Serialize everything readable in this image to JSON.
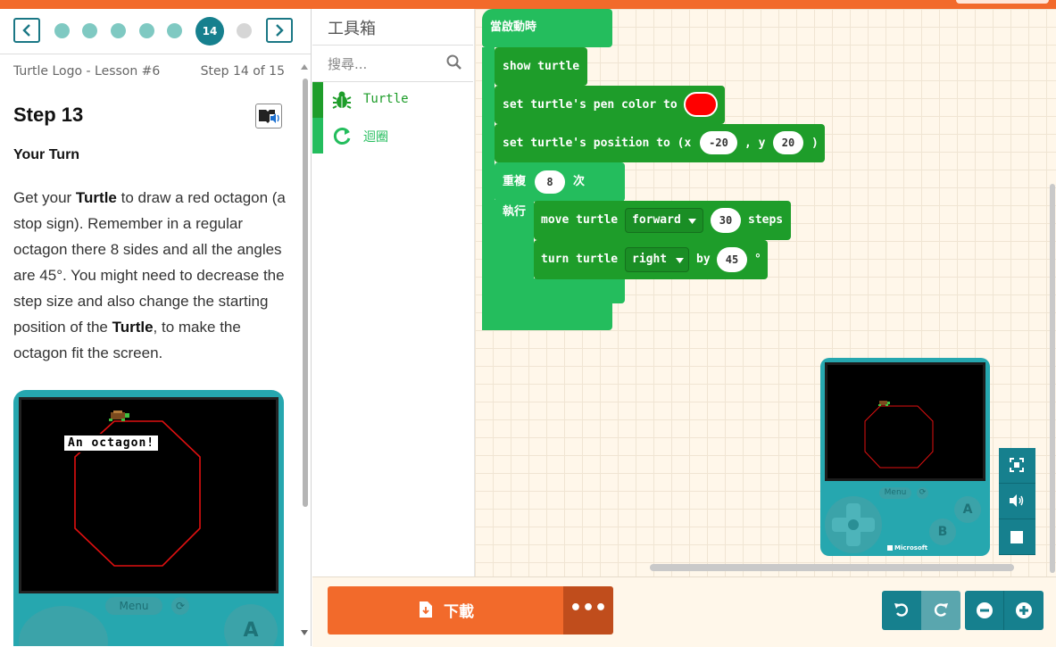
{
  "tutorial": {
    "nav": {
      "current_step": "14"
    },
    "tutorial_name": "Turtle Logo - Lesson #6",
    "step_counter": "Step 14 of 15",
    "step_title": "Step 13",
    "subtitle": "Your Turn",
    "paragraph": {
      "p1": "Get your ",
      "b1": "Turtle",
      "p2": " to draw a red octagon (a stop sign). Remember in a regular octagon there 8 sides and all the angles are 45°. You might need to decrease the step size and also change the starting position of the ",
      "b2": "Turtle",
      "p3": ", to make the octagon fit the screen."
    },
    "preview": {
      "speech": "An octagon!",
      "menu_label": "Menu",
      "a_label": "A"
    }
  },
  "toolbox": {
    "title": "工具箱",
    "search_placeholder": "搜尋...",
    "categories": [
      {
        "label": "Turtle",
        "color": "#1e9d2a",
        "icon": "bug-icon"
      },
      {
        "label": "迴圈",
        "color": "#24bd5d",
        "icon": "loop-icon"
      }
    ]
  },
  "blocks": {
    "on_start": "當啟動時",
    "show_turtle": "show turtle",
    "set_pen_color": "set turtle's pen color to",
    "pen_color": "#ff0000",
    "set_position_prefix": "set turtle's position to (x",
    "x_value": "-20",
    "y_sep": ", y",
    "y_value": "20",
    "close_paren": ")",
    "repeat_label": "重複",
    "repeat_count": "8",
    "times_label": "次",
    "do_label": "執行",
    "move_label": "move turtle",
    "move_direction": "forward",
    "move_steps": "30",
    "steps_label": "steps",
    "turn_label": "turn turtle",
    "turn_direction": "right",
    "by_label": "by",
    "turn_angle": "45",
    "degree_symbol": "°"
  },
  "simulator": {
    "menu_label": "Menu",
    "a_label": "A",
    "b_label": "B",
    "brand": "Microsoft"
  },
  "bottom": {
    "download_label": "下載",
    "more_label": "•••"
  },
  "colors": {
    "accent_orange": "#f26a2b",
    "teal": "#16808e",
    "turtle_block": "#1e9d2a",
    "loop_block": "#24bd5d"
  }
}
